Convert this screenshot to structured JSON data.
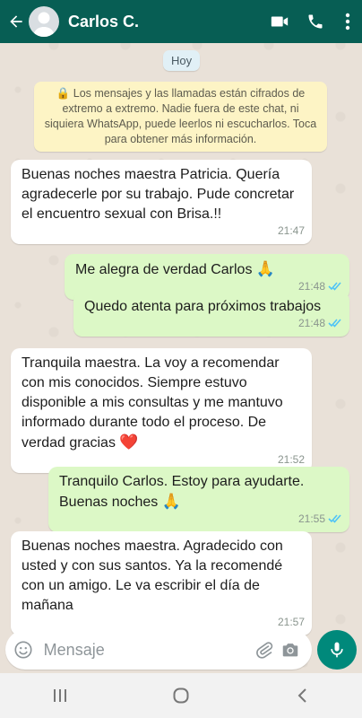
{
  "header": {
    "contact_name": "Carlos C."
  },
  "date_chip": "Hoy",
  "encryption_notice": "🔒 Los mensajes y las llamadas están cifrados de extremo a extremo. Nadie fuera de este chat, ni siquiera WhatsApp, puede leerlos ni escucharlos. Toca para obtener más información.",
  "messages": [
    {
      "direction": "in",
      "text": "Buenas noches maestra Patricia. Quería agradecerle por su trabajo. Pude concretar el encuentro sexual con Brisa.!!",
      "time": "21:47"
    },
    {
      "direction": "out",
      "text": "Me alegra de verdad Carlos",
      "emoji": "🙏",
      "time": "21:48",
      "status": "read"
    },
    {
      "direction": "out",
      "text": "Quedo atenta para próximos trabajos",
      "time": "21:48",
      "status": "read"
    },
    {
      "direction": "in",
      "text": "Tranquila maestra. La voy a recomendar con mis conocidos. Siempre estuvo disponible a mis consultas y me mantuvo informado durante todo el proceso. De verdad gracias",
      "emoji": "❤️",
      "time": "21:52"
    },
    {
      "direction": "out",
      "text": "Tranquilo Carlos. Estoy para ayudarte. Buenas noches",
      "emoji": "🙏",
      "time": "21:55",
      "status": "read"
    },
    {
      "direction": "in",
      "text": "Buenas noches maestra. Agradecido con usted y con sus santos. Ya la recomendé con un amigo. Le va escribir el día de mañana",
      "time": "21:57"
    }
  ],
  "composer": {
    "placeholder": "Mensaje"
  },
  "colors": {
    "header": "#075e54",
    "outgoing": "#dcf8c6",
    "incoming": "#ffffff",
    "read_ticks": "#4fc3f7",
    "mic": "#00897b"
  }
}
